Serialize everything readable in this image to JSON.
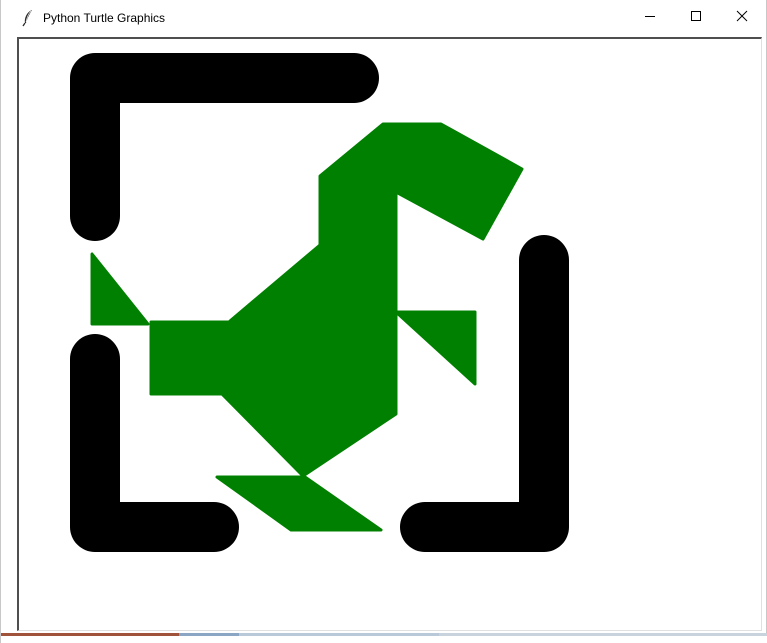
{
  "window": {
    "title": "Python Turtle Graphics",
    "icon": "feather-icon",
    "controls": {
      "minimize_icon": "minimize-icon",
      "maximize_icon": "maximize-icon",
      "close_icon": "close-icon"
    }
  },
  "canvas": {
    "background": "#ffffff",
    "colors": {
      "frame": "#000000",
      "dinosaur": "#008000"
    }
  }
}
